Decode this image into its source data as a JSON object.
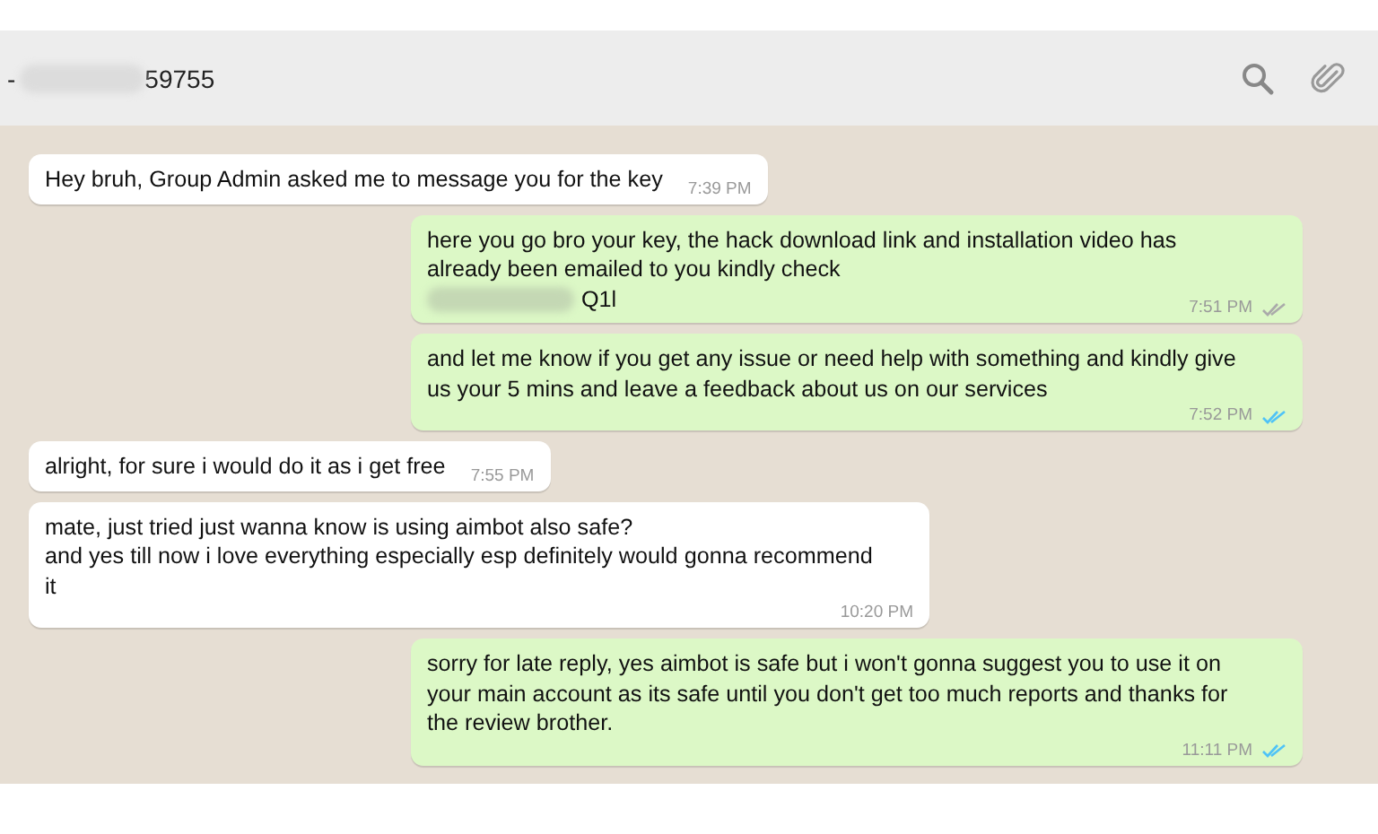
{
  "header": {
    "contact_prefix": "-",
    "contact_suffix": "59755"
  },
  "messages": [
    {
      "kind": "incoming",
      "text": "Hey bruh, Group Admin asked me to message you for the key",
      "time": "7:39 PM"
    },
    {
      "kind": "outgoing",
      "text": "here you go bro your key, the hack download link and installation video has\nalready been emailed to you kindly check",
      "key_tail": "Q1l",
      "time": "7:51 PM",
      "read": false
    },
    {
      "kind": "outgoing",
      "text": "and let me know if you get any issue or need help with something and kindly give\nus your 5 mins and leave a feedback about us on our services",
      "time": "7:52 PM",
      "read": true
    },
    {
      "kind": "incoming",
      "text": "alright, for sure i would do it as i get free",
      "time": "7:55 PM"
    },
    {
      "kind": "incoming",
      "text": "mate, just tried just wanna know is using aimbot also safe?\nand yes till now i love everything especially esp definitely would gonna recommend\nit",
      "time": "10:20 PM"
    },
    {
      "kind": "outgoing",
      "text": "sorry for late reply, yes aimbot is safe but i won't gonna suggest you to use it on\nyour main account as its safe until you don't get too much reports and thanks for\nthe review brother.",
      "time": "11:11 PM",
      "read": true
    }
  ]
}
